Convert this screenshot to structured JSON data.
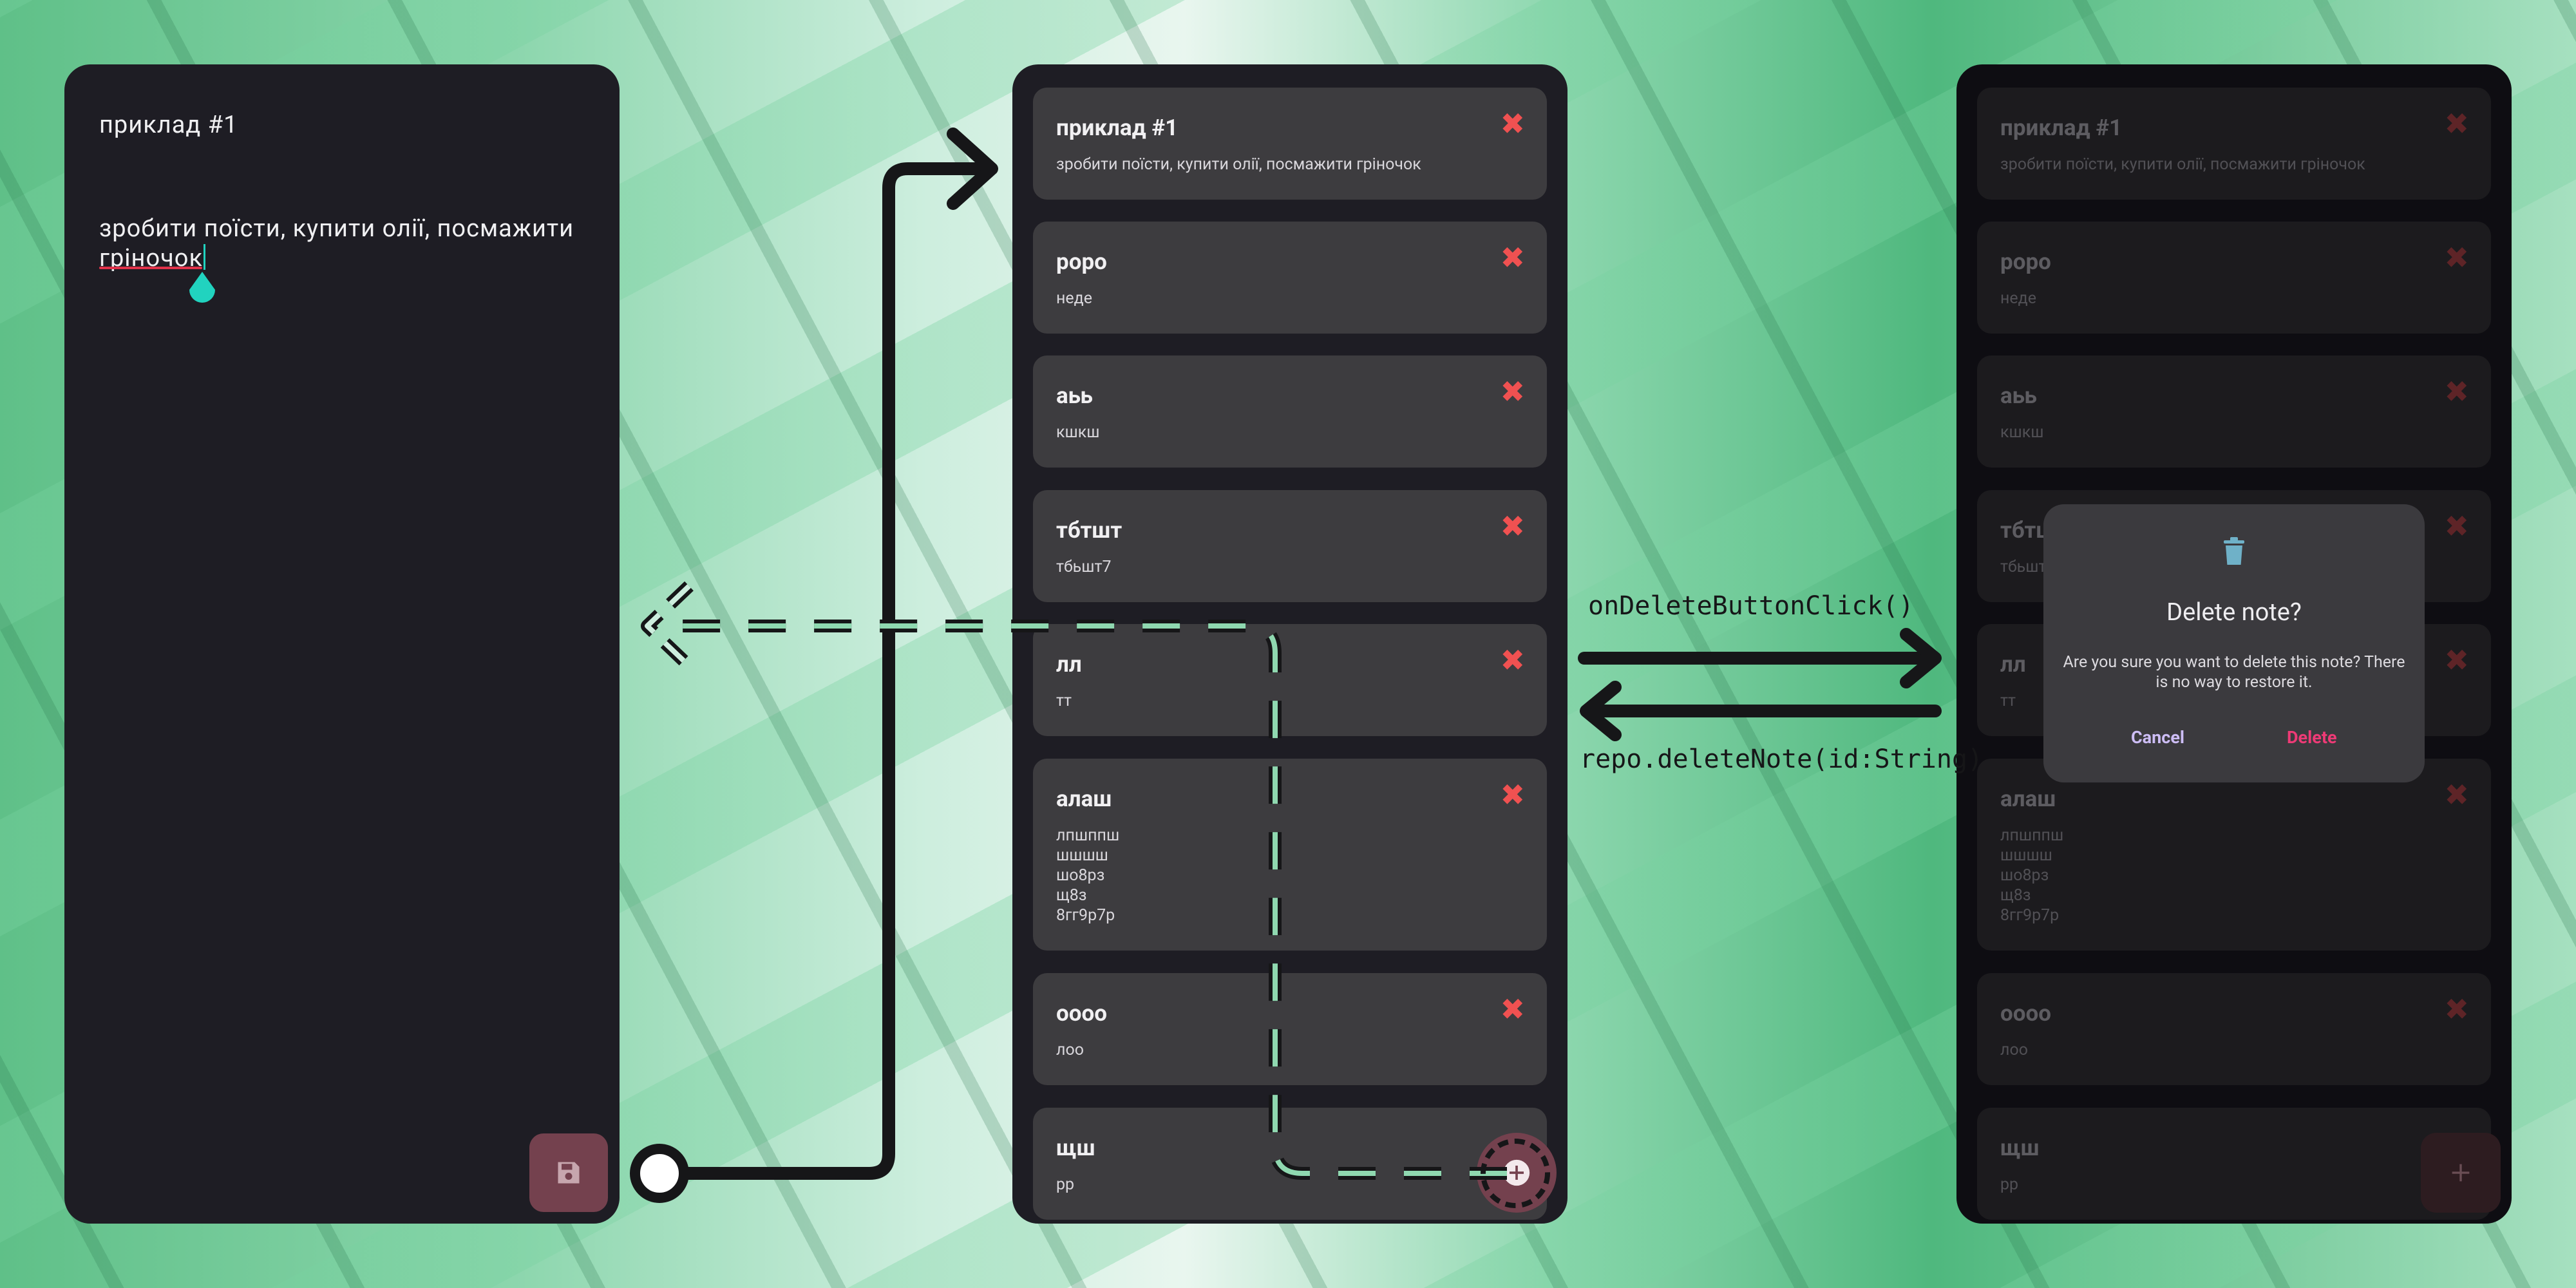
{
  "editor": {
    "title": "приклад #1",
    "body": "зробити поїсти, купити олії, посмажити гріночок",
    "save_icon": "floppy-disk-icon"
  },
  "note_list": {
    "notes": [
      {
        "title": "приклад #1",
        "body": "зробити поїсти, купити олії, посмажити гріночок"
      },
      {
        "title": "роро",
        "body": "неде"
      },
      {
        "title": "аьь",
        "body": "кшкш"
      },
      {
        "title": "тбтшт",
        "body": "тбьшт7"
      },
      {
        "title": "лл",
        "body": "тт"
      },
      {
        "title": "алаш",
        "body": "лпшппш\nшшшш\nшо8рз\nщ8з\n8гг9р7р"
      },
      {
        "title": "оооо",
        "body": "лоо"
      },
      {
        "title": "щш",
        "body": "рр"
      }
    ],
    "delete_glyph": "✖",
    "add_glyph": "+"
  },
  "dialog": {
    "icon": "trash-icon",
    "title": "Delete note?",
    "message": "Are you sure you want to delete this note? There is no way to restore it.",
    "cancel_label": "Cancel",
    "delete_label": "Delete"
  },
  "annotations": {
    "forward_call": "onDeleteButtonClick()",
    "return_call": "repo.deleteNote(id:String)"
  },
  "colors": {
    "screen_bg": "#1e1d24",
    "card_bg": "#3d3c3f",
    "delete_red": "#f05151",
    "accent_teal": "#21d3bf",
    "fab_bg": "#74414e",
    "dialog_delete": "#ee3a76",
    "dialog_cancel": "#cdbdf5"
  }
}
